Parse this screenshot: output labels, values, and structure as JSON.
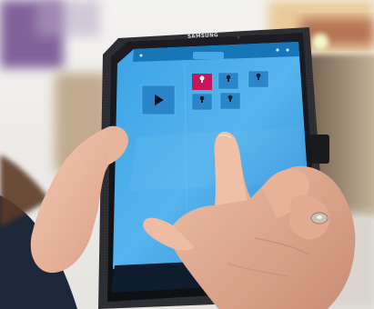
{
  "device": {
    "brand": "SAMSUNG"
  },
  "screen": {
    "title": "",
    "left_column_label": "",
    "right_column_label": "",
    "tiles": [
      {
        "label": "",
        "state": "selected",
        "icon": "lightbulb-icon",
        "color": "#c2185b"
      },
      {
        "label": "",
        "state": "idle",
        "icon": "lightbulb-icon"
      },
      {
        "label": "",
        "state": "idle",
        "icon": "lightbulb-icon"
      },
      {
        "label": "",
        "state": "idle",
        "icon": "lightbulb-icon"
      },
      {
        "label": "",
        "state": "idle",
        "icon": "lightbulb-icon"
      }
    ],
    "play_icon": "play-icon",
    "status_text": "",
    "accent_color": "#3ba3e6"
  }
}
